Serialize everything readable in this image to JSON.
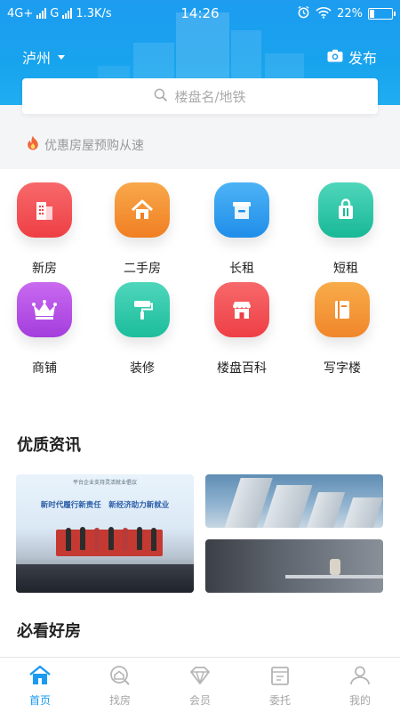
{
  "status_bar": {
    "network": "4G+",
    "carrier": "G",
    "speed": "1.3K/s",
    "time": "14:26",
    "battery": "22%",
    "battery_level": 0.22
  },
  "header": {
    "city": "泸州",
    "publish_label": "发布",
    "search_placeholder": "楼盘名/地铁"
  },
  "promo": {
    "text": "优惠房屋预购从速"
  },
  "categories": [
    {
      "label": "新房",
      "icon": "building-icon",
      "color": "#f05257"
    },
    {
      "label": "二手房",
      "icon": "house-icon",
      "color": "#f38d2f"
    },
    {
      "label": "长租",
      "icon": "box-icon",
      "color": "#2d9cf0"
    },
    {
      "label": "短租",
      "icon": "bag-icon",
      "color": "#22c2a4"
    },
    {
      "label": "商铺",
      "icon": "crown-icon",
      "color": "#b44ee6"
    },
    {
      "label": "装修",
      "icon": "paint-roller-icon",
      "color": "#2fc6a8"
    },
    {
      "label": "楼盘百科",
      "icon": "shop-icon",
      "color": "#f0484e"
    },
    {
      "label": "写字楼",
      "icon": "book-icon",
      "color": "#f39a2b"
    }
  ],
  "news": {
    "title": "优质资讯",
    "big_small_text": "平台企业支持灵活就业倡议",
    "big_line": "新时代履行新责任　新经济助力新就业"
  },
  "recommend": {
    "title": "必看好房"
  },
  "tabs": [
    {
      "label": "首页",
      "icon": "home-icon",
      "active": true
    },
    {
      "label": "找房",
      "icon": "find-house-icon",
      "active": false
    },
    {
      "label": "会员",
      "icon": "diamond-icon",
      "active": false
    },
    {
      "label": "委托",
      "icon": "delegate-icon",
      "active": false
    },
    {
      "label": "我的",
      "icon": "person-icon",
      "active": false
    }
  ],
  "colors": {
    "accent": "#1a9af0",
    "header_blue": "#1d9cf0",
    "tab_inactive": "#a5a5a5"
  }
}
